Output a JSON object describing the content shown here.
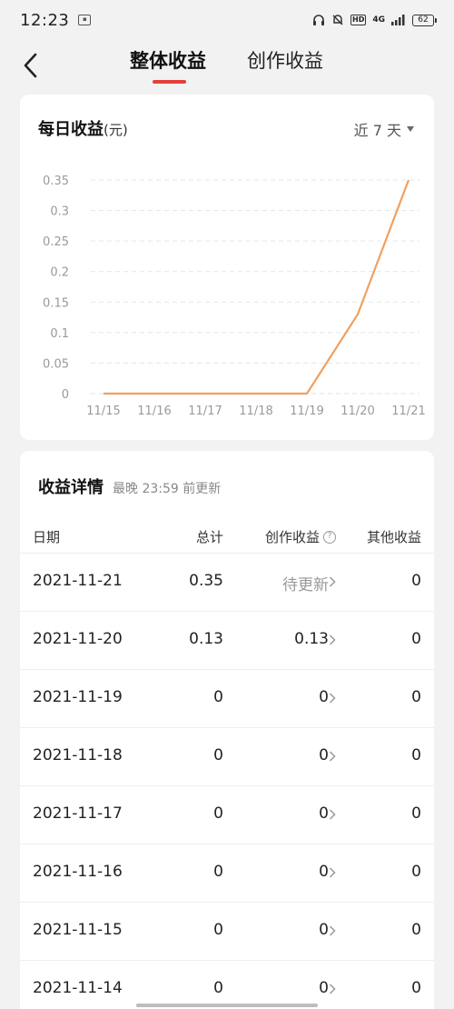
{
  "status_bar": {
    "time": "12:23",
    "notif_icon": "app-notification-icon",
    "hd": "HD",
    "network": "4G",
    "battery": "62"
  },
  "header": {
    "tabs": [
      {
        "label": "整体收益",
        "active": true
      },
      {
        "label": "创作收益",
        "active": false
      }
    ],
    "accent": "#e3403a"
  },
  "chart_card": {
    "title": "每日收益",
    "unit": "(元)",
    "range": "近 7 天"
  },
  "chart_data": {
    "type": "line",
    "x": [
      "11/15",
      "11/16",
      "11/17",
      "11/18",
      "11/19",
      "11/20",
      "11/21"
    ],
    "series": [
      {
        "values": [
          0,
          0,
          0,
          0,
          0,
          0.13,
          0.35
        ],
        "color": "#f0a060"
      }
    ],
    "ylim": [
      0,
      0.35
    ],
    "yticks": [
      "0",
      "0.05",
      "0.1",
      "0.15",
      "0.2",
      "0.25",
      "0.3",
      "0.35"
    ],
    "grid": true
  },
  "details": {
    "title": "收益详情",
    "subtitle": "最晚 23:59 前更新",
    "columns": {
      "date": "日期",
      "total": "总计",
      "creation": "创作收益",
      "other": "其他收益"
    },
    "rows": [
      {
        "date": "2021-11-21",
        "total": "0.35",
        "creation": "待更新",
        "other": "0",
        "pending": true
      },
      {
        "date": "2021-11-20",
        "total": "0.13",
        "creation": "0.13",
        "other": "0",
        "pending": false
      },
      {
        "date": "2021-11-19",
        "total": "0",
        "creation": "0",
        "other": "0",
        "pending": false
      },
      {
        "date": "2021-11-18",
        "total": "0",
        "creation": "0",
        "other": "0",
        "pending": false
      },
      {
        "date": "2021-11-17",
        "total": "0",
        "creation": "0",
        "other": "0",
        "pending": false
      },
      {
        "date": "2021-11-16",
        "total": "0",
        "creation": "0",
        "other": "0",
        "pending": false
      },
      {
        "date": "2021-11-15",
        "total": "0",
        "creation": "0",
        "other": "0",
        "pending": false
      },
      {
        "date": "2021-11-14",
        "total": "0",
        "creation": "0",
        "other": "0",
        "pending": false
      }
    ]
  }
}
